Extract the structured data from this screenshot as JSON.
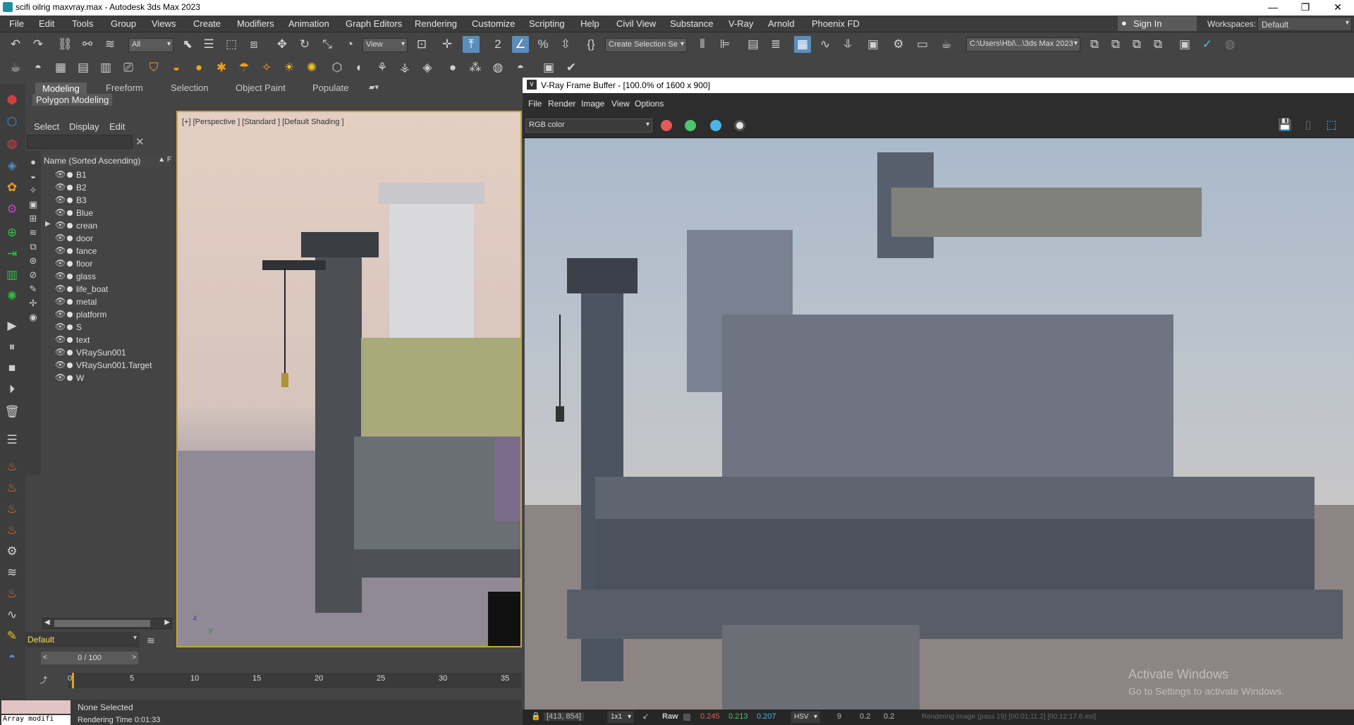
{
  "window": {
    "title": "scifi oilrig maxvray.max - Autodesk 3ds Max 2023",
    "min": "—",
    "max": "❐",
    "close": "✕"
  },
  "menu": [
    "File",
    "Edit",
    "Tools",
    "Group",
    "Views",
    "Create",
    "Modifiers",
    "Animation",
    "Graph Editors",
    "Rendering",
    "Customize",
    "Scripting",
    "Help",
    "Civil View",
    "Substance",
    "V-Ray",
    "Arnold",
    "Phoenix FD"
  ],
  "signin": "Sign In",
  "workspaces": {
    "label": "Workspaces:",
    "value": "Default"
  },
  "toolbar": {
    "selection_filter": "All",
    "reference_coord": "View",
    "named_selection": "Create Selection Se",
    "project_path": "C:\\Users\\Hbi\\...\\3ds Max 2023"
  },
  "ribbon": {
    "tabs": [
      "Modeling",
      "Freeform",
      "Selection",
      "Object Paint",
      "Populate"
    ],
    "panel": "Polygon Modeling"
  },
  "scene_explorer": {
    "tabs": [
      "Select",
      "Display",
      "Edit"
    ],
    "header": "Name (Sorted Ascending)",
    "sort_arrow": "▲ F",
    "items": [
      "B1",
      "B2",
      "B3",
      "Blue",
      "crean",
      "door",
      "fance",
      "floor",
      "glass",
      "life_boat",
      "metal",
      "platform",
      "S",
      "text",
      "VRaySun001",
      "VRaySun001.Target",
      "W"
    ],
    "layer": "Default"
  },
  "viewport": {
    "label": "[+] [Perspective ] [Standard ] [Default Shading ]",
    "axis_z": "z",
    "axis_y": "y"
  },
  "framebuffer": {
    "title": "V-Ray Frame Buffer - [100.0% of 1600 x 900]",
    "menu": [
      "File",
      "Render",
      "Image",
      "View",
      "Options"
    ],
    "channel": "RGB color",
    "status": {
      "coords": "[413, 854]",
      "zoom": "1x1",
      "raw": "Raw",
      "r": "0.245",
      "g": "0.213",
      "b": "0.207",
      "mode": "HSV",
      "h": "9",
      "s": "0.2",
      "v": "0.2",
      "message": "Rendering image (pass 19) [00:01:11.2] [00:12:17.6 est]"
    },
    "watermark_title": "Activate Windows",
    "watermark_sub": "Go to Settings to activate Windows."
  },
  "timeline": {
    "frame": "0 / 100",
    "ticks": [
      "0",
      "5",
      "10",
      "15",
      "20",
      "25",
      "30",
      "35"
    ]
  },
  "status": {
    "selection": "None Selected",
    "render_time": "Rendering Time  0:01:33",
    "command": "Array modifi"
  }
}
